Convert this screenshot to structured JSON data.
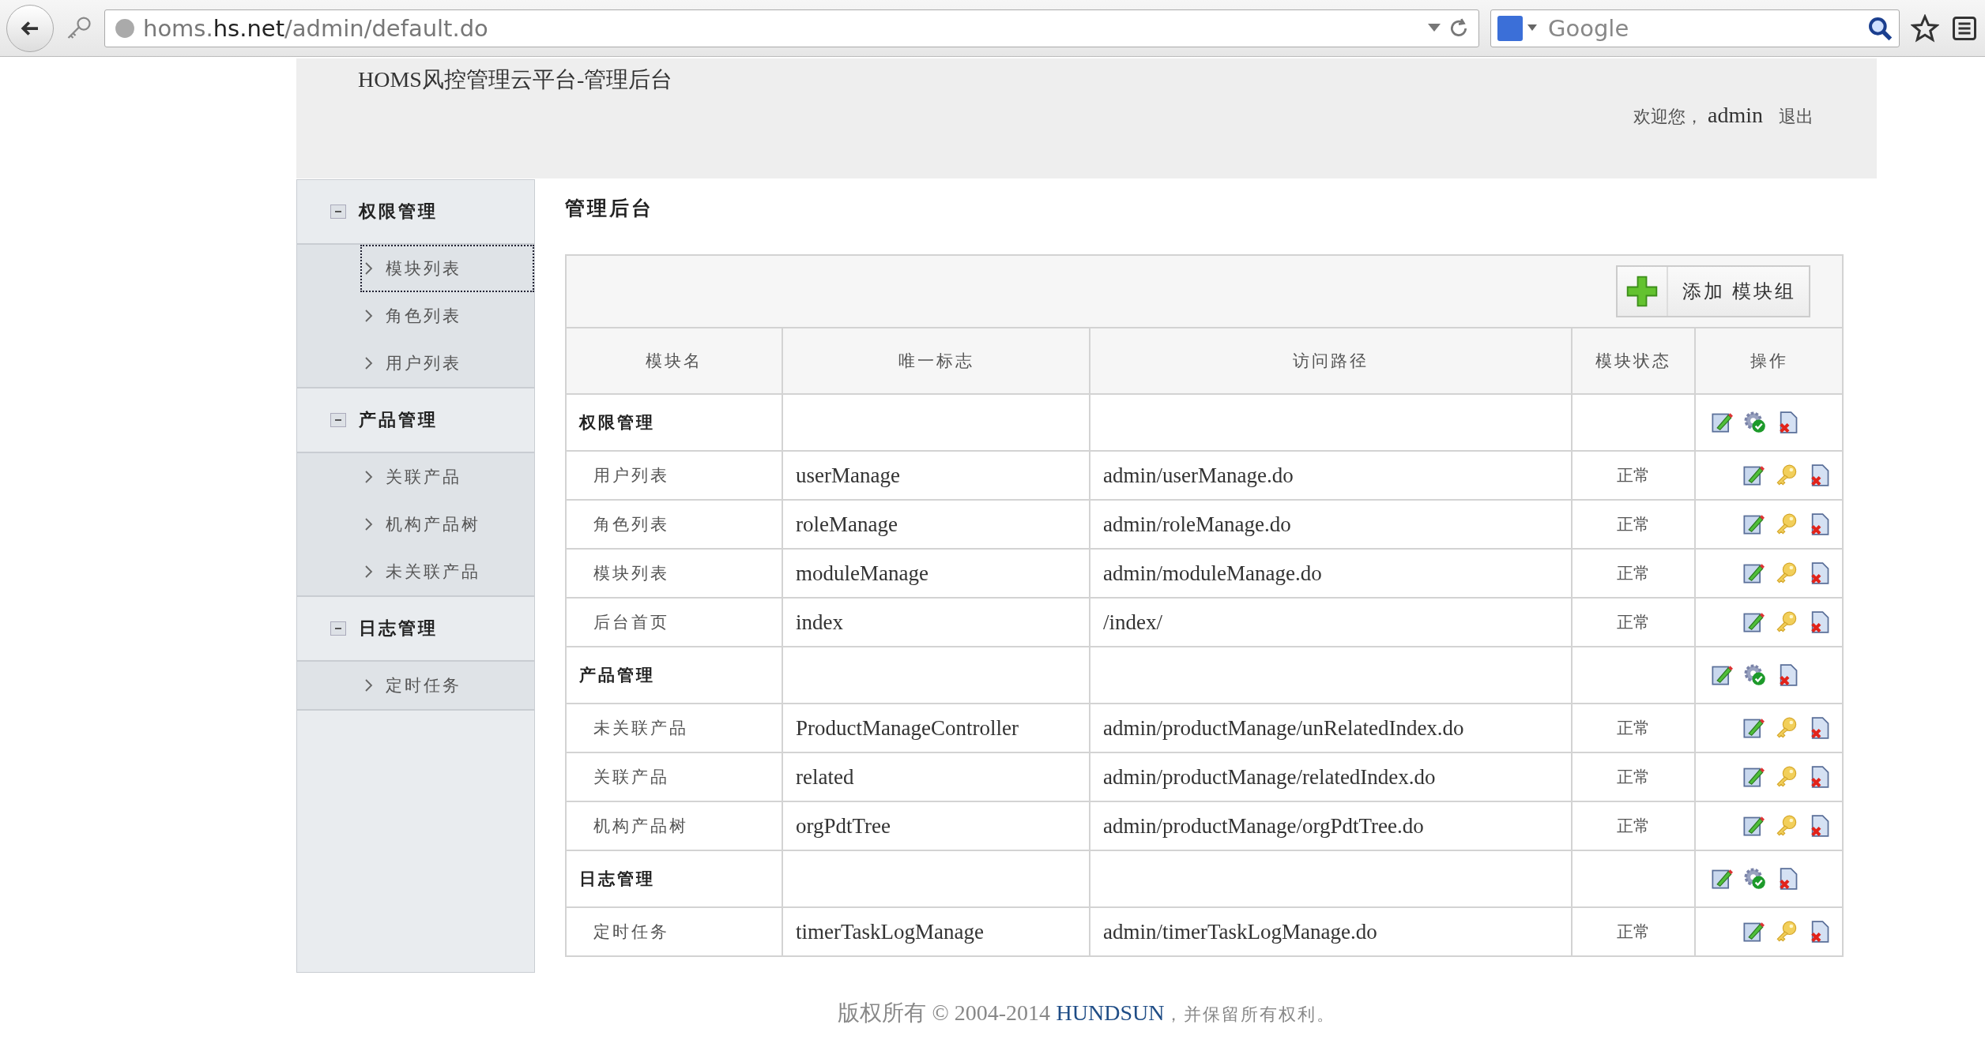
{
  "browser": {
    "url_host_pre": "homs.",
    "url_host": "hs.net",
    "url_path": "/admin/default.do",
    "search_placeholder": "Google"
  },
  "header": {
    "title": "HOMS风控管理云平台-管理后台",
    "welcome": "欢迎您，",
    "user": "admin",
    "logout": "退出"
  },
  "sidebar": {
    "groups": [
      {
        "label": "权限管理",
        "expanded": true,
        "items": [
          {
            "label": "模块列表",
            "selected": true
          },
          {
            "label": "角色列表",
            "selected": false
          },
          {
            "label": "用户列表",
            "selected": false
          }
        ]
      },
      {
        "label": "产品管理",
        "expanded": true,
        "items": [
          {
            "label": "关联产品",
            "selected": false
          },
          {
            "label": "机构产品树",
            "selected": false
          },
          {
            "label": "未关联产品",
            "selected": false
          }
        ]
      },
      {
        "label": "日志管理",
        "expanded": true,
        "items": [
          {
            "label": "定时任务",
            "selected": false
          }
        ]
      }
    ]
  },
  "main": {
    "title": "管理后台",
    "add_button": "添加 模块组",
    "columns": [
      "模块名",
      "唯一标志",
      "访问路径",
      "模块状态",
      "操作"
    ],
    "groups": [
      {
        "name": "权限管理",
        "rows": [
          {
            "name": "用户列表",
            "id": "userManage",
            "path": "admin/userManage.do",
            "status": "正常"
          },
          {
            "name": "角色列表",
            "id": "roleManage",
            "path": "admin/roleManage.do",
            "status": "正常"
          },
          {
            "name": "模块列表",
            "id": "moduleManage",
            "path": "admin/moduleManage.do",
            "status": "正常"
          },
          {
            "name": "后台首页",
            "id": "index",
            "path": "/index/",
            "status": "正常"
          }
        ]
      },
      {
        "name": "产品管理",
        "rows": [
          {
            "name": "未关联产品",
            "id": "ProductManageController",
            "path": "admin/productManage/unRelatedIndex.do",
            "status": "正常"
          },
          {
            "name": "关联产品",
            "id": "related",
            "path": "admin/productManage/relatedIndex.do",
            "status": "正常"
          },
          {
            "name": "机构产品树",
            "id": "orgPdtTree",
            "path": "admin/productManage/orgPdtTree.do",
            "status": "正常"
          }
        ]
      },
      {
        "name": "日志管理",
        "rows": [
          {
            "name": "定时任务",
            "id": "timerTaskLogManage",
            "path": "admin/timerTaskLogManage.do",
            "status": "正常"
          }
        ]
      }
    ]
  },
  "footer": {
    "prefix": "版权所有 © 2004-2014",
    "link": "HUNDSUN",
    "suffix": "，并保留所有权利。"
  }
}
